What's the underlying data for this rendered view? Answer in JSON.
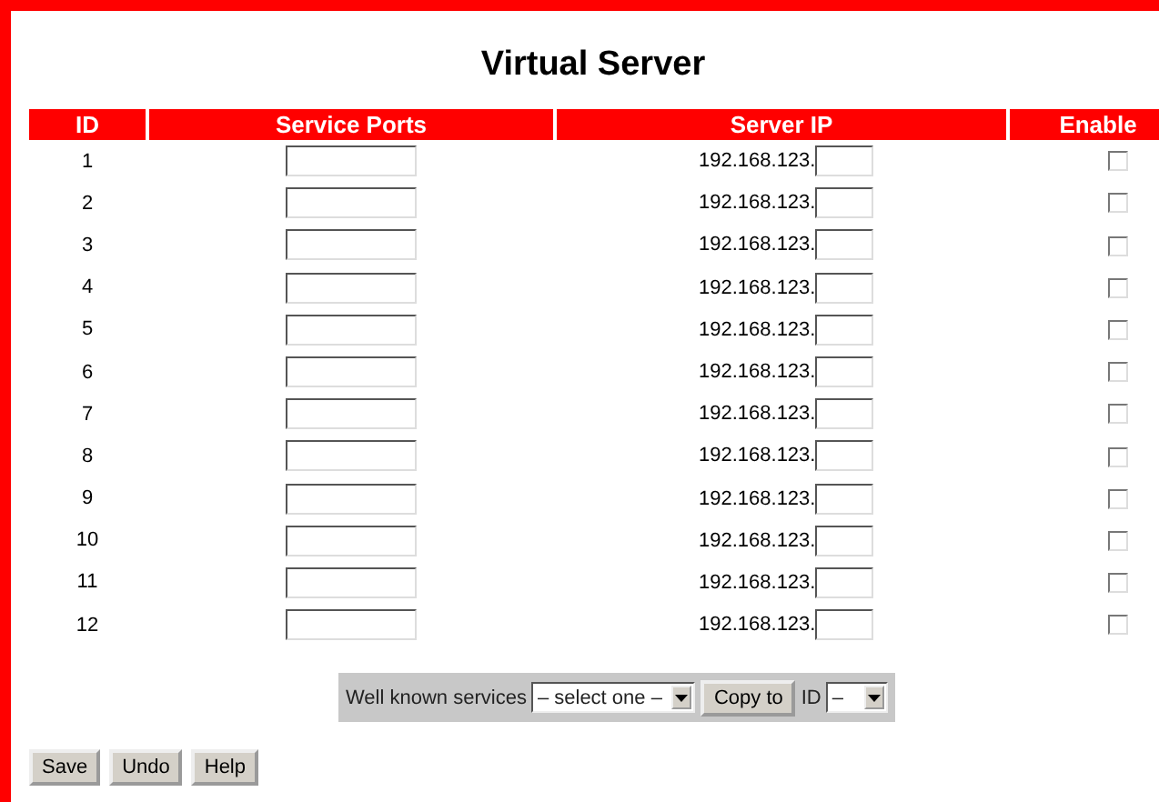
{
  "title": "Virtual Server",
  "table": {
    "columns": [
      "ID",
      "Service Ports",
      "Server IP",
      "Enable"
    ],
    "rows": [
      {
        "id": "1",
        "ip_prefix": "192.168.123.",
        "enabled": false
      },
      {
        "id": "2",
        "ip_prefix": "192.168.123.",
        "enabled": false
      },
      {
        "id": "3",
        "ip_prefix": "192.168.123.",
        "enabled": false
      },
      {
        "id": "4",
        "ip_prefix": "192.168.123.",
        "enabled": false
      },
      {
        "id": "5",
        "ip_prefix": "192.168.123.",
        "enabled": false
      },
      {
        "id": "6",
        "ip_prefix": "192.168.123.",
        "enabled": false
      },
      {
        "id": "7",
        "ip_prefix": "192.168.123.",
        "enabled": false
      },
      {
        "id": "8",
        "ip_prefix": "192.168.123.",
        "enabled": false
      },
      {
        "id": "9",
        "ip_prefix": "192.168.123.",
        "enabled": false
      },
      {
        "id": "10",
        "ip_prefix": "192.168.123.",
        "enabled": false
      },
      {
        "id": "11",
        "ip_prefix": "192.168.123.",
        "enabled": false
      },
      {
        "id": "12",
        "ip_prefix": "192.168.123.",
        "enabled": false
      }
    ]
  },
  "services_bar": {
    "label": "Well known services",
    "service_select": "– select one –",
    "copy_button": "Copy to",
    "id_label": "ID",
    "id_select": "–"
  },
  "buttons": [
    "Save",
    "Undo",
    "Help"
  ]
}
